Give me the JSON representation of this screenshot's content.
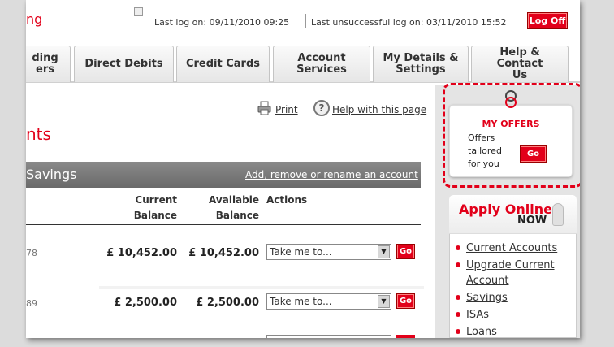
{
  "header": {
    "brand_fragment": "ng",
    "last_log_on": "Last log on: 09/11/2010 09:25",
    "last_unsuccessful": "Last unsuccessful log on: 03/11/2010 15:52",
    "log_off": "Log Off"
  },
  "tabs": [
    {
      "line1": "ding",
      "line2": "ers"
    },
    {
      "line1": "Direct Debits",
      "line2": ""
    },
    {
      "line1": "Credit Cards",
      "line2": ""
    },
    {
      "line1": "Account",
      "line2": "Services"
    },
    {
      "line1": "My Details &",
      "line2": "Settings"
    },
    {
      "line1": "Help & Contact",
      "line2": "Us"
    }
  ],
  "page": {
    "print_label": "Print",
    "help_label": "Help with this page",
    "title_fragment": "nts"
  },
  "section": {
    "title": "Savings",
    "manage_link": "Add, remove or rename an account"
  },
  "table": {
    "headers": {
      "current_line1": "Current",
      "current_line2": "Balance",
      "available_line1": "Available",
      "available_line2": "Balance",
      "actions": "Actions"
    },
    "rows": [
      {
        "account_fragment": "78",
        "current": "£ 10,452.00",
        "available": "£ 10,452.00",
        "action_select": "Take me to...",
        "go": "Go"
      },
      {
        "account_fragment": "89",
        "current": "£ 2,500.00",
        "available": "£ 2,500.00",
        "action_select": "Take me to...",
        "go": "Go"
      }
    ]
  },
  "offers": {
    "title": "MY OFFERS",
    "text_line1": "Offers",
    "text_line2": "tailored",
    "text_line3": "for you",
    "go": "Go"
  },
  "apply": {
    "title": "Apply Online",
    "now": "NOW",
    "links": [
      "Current Accounts",
      "Upgrade Current",
      "Account",
      "Savings",
      "ISAs",
      "Loans"
    ]
  },
  "colors": {
    "brand_red": "#e2001a",
    "section_bar": "#7a7a7a",
    "sidebar_bg": "#e4e4e4"
  }
}
